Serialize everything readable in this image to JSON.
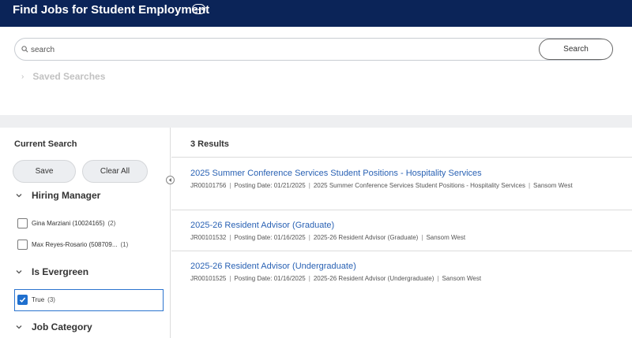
{
  "header": {
    "title": "Find Jobs for Student Employment"
  },
  "search": {
    "placeholder": "search",
    "value": "",
    "button_label": "Search"
  },
  "saved_searches": {
    "label": "Saved Searches"
  },
  "sidebar": {
    "heading": "Current Search",
    "save_label": "Save",
    "clear_label": "Clear All",
    "facets": [
      {
        "label": "Hiring Manager",
        "options": [
          {
            "text": "Gina Marziani (10024165)",
            "count": "(2)",
            "checked": false
          },
          {
            "text": "Max Reyes-Rosario (508709...",
            "count": "(1)",
            "checked": false
          }
        ]
      },
      {
        "label": "Is Evergreen",
        "options": [
          {
            "text": "True",
            "count": "(3)",
            "checked": true
          }
        ]
      },
      {
        "label": "Job Category",
        "options": []
      }
    ]
  },
  "results": {
    "count_label": "3 Results",
    "jobs": [
      {
        "title": "2025 Summer Conference Services Student Positions - Hospitality Services",
        "id": "JR00101756",
        "posting_date": "Posting Date: 01/21/2025",
        "position": "2025 Summer Conference Services Student Positions - Hospitality Services",
        "location": "Sansom West"
      },
      {
        "title": "2025-26 Resident Advisor (Graduate)",
        "id": "JR00101532",
        "posting_date": "Posting Date: 01/16/2025",
        "position": "2025-26 Resident Advisor (Graduate)",
        "location": "Sansom West"
      },
      {
        "title": "2025-26 Resident Advisor (Undergraduate)",
        "id": "JR00101525",
        "posting_date": "Posting Date: 01/16/2025",
        "position": "2025-26 Resident Advisor (Undergraduate)",
        "location": "Sansom West"
      }
    ]
  },
  "colors": {
    "header_bg": "#0b2458",
    "link": "#2a62b4",
    "checkbox_checked": "#1f6fce"
  }
}
